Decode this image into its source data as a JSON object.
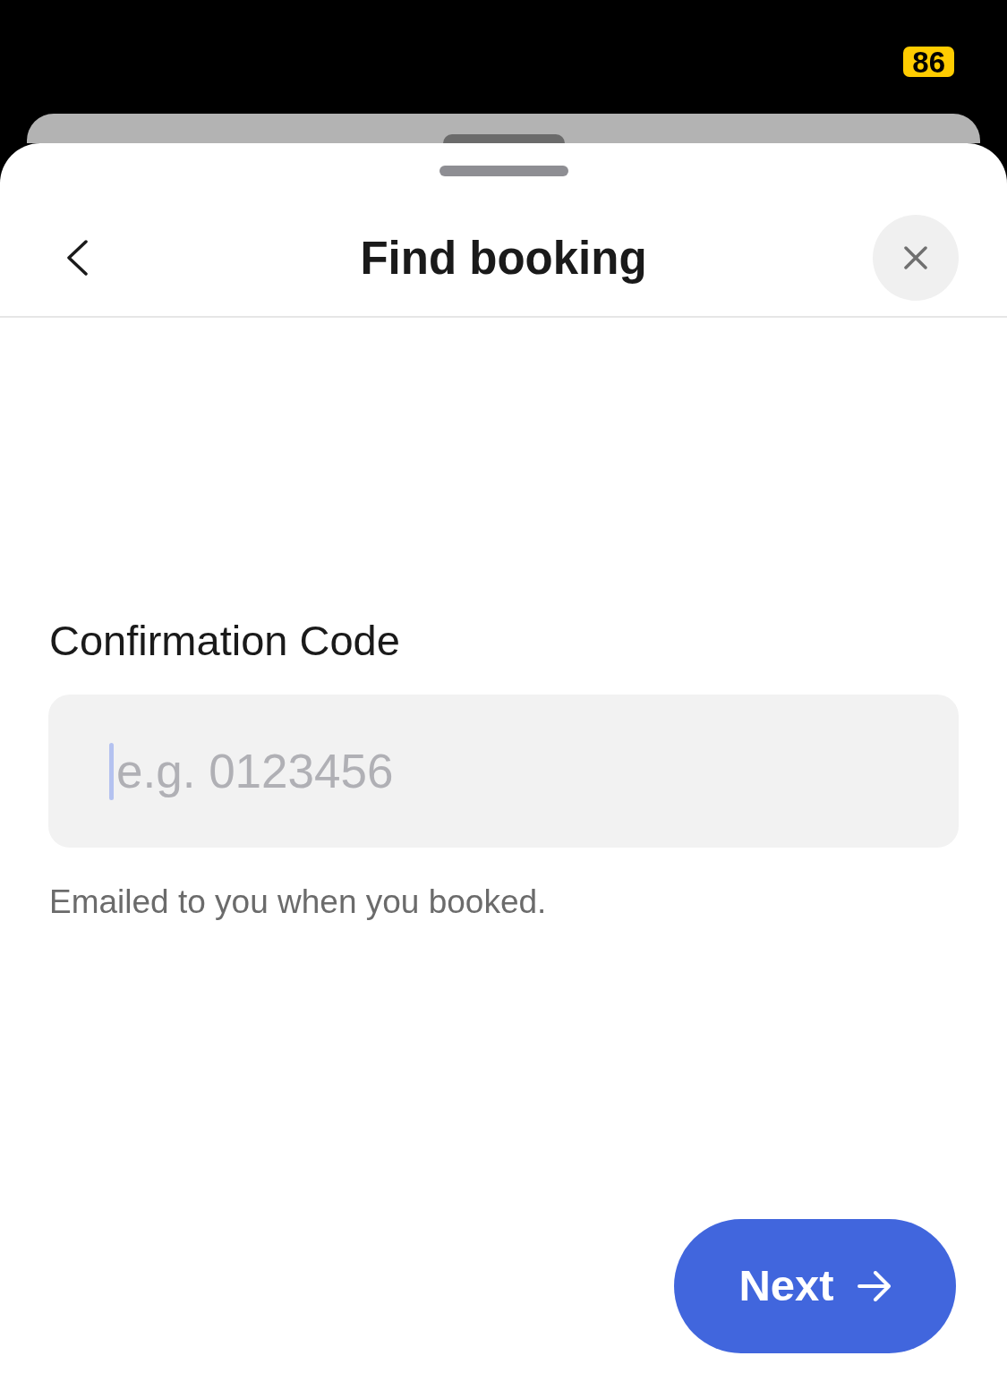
{
  "status_bar": {
    "battery": "86"
  },
  "header": {
    "title": "Find booking"
  },
  "field": {
    "label": "Confirmation Code",
    "placeholder": "e.g. 0123456",
    "focused": true,
    "hint": "Emailed to you when you booked."
  },
  "primary_button": {
    "label": "Next"
  }
}
